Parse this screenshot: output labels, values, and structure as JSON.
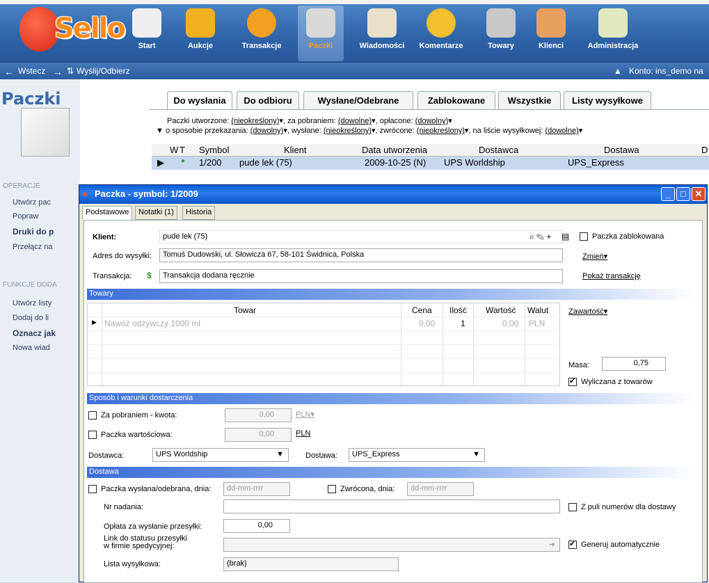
{
  "nav": {
    "items": [
      {
        "label": "Start",
        "color": "#eeeeee"
      },
      {
        "label": "Aukcje",
        "color": "#f0b020"
      },
      {
        "label": "Transakcje",
        "color": "#f2a020"
      },
      {
        "label": "Paczki",
        "color": "#d8d8d8"
      },
      {
        "label": "Wiadomości",
        "color": "#e8e0c8"
      },
      {
        "label": "Komentarze",
        "color": "#f2c030"
      },
      {
        "label": "Towary",
        "color": "#c8c8c8"
      },
      {
        "label": "Klienci",
        "color": "#e8a060"
      },
      {
        "label": "Administracja",
        "color": "#e0e8c0"
      }
    ],
    "logo": "Sello"
  },
  "toolbar": {
    "back": "Wstecz",
    "forward_icon": "→",
    "send": "Wyślij/Odbierz",
    "account": "Konto: ins_demo na"
  },
  "left": {
    "title": "Paczki",
    "section1": "OPERACJE",
    "ops": [
      "Utwórz pac",
      "Popraw",
      "Druki do p",
      "Przełącz na"
    ],
    "section2": "FUNKCJE DODA",
    "funcs": [
      "Utwórz listy",
      "Dodaj do li",
      "Oznacz jak",
      "Nowa wiad"
    ]
  },
  "tabs": [
    "Do wysłania",
    "Do odbioru",
    "Wysłane/Odebrane",
    "Zablokowane",
    "Wszystkie",
    "Listy wysyłkowe"
  ],
  "filters": {
    "l1a": "Paczki utworzone:",
    "v1a": "(nieokreślony)",
    "l1b": ", za pobraniem:",
    "v1b": "(dowolne)",
    "l1c": ", opłacone:",
    "v1c": "(dowolny)",
    "l2a": "o sposobie przekazania:",
    "v2a": "(dowolny)",
    "l2b": ", wysłane:",
    "v2b": "(nieokreślony)",
    "l2c": ", zwrócone:",
    "v2c": "(nieokreślony)",
    "l2d": ", na liście wysyłkowej:",
    "v2d": "(dowolne)"
  },
  "table": {
    "headers": [
      "W",
      "T",
      "Symbol",
      "Klient",
      "Data utworzenia",
      "Dostawca",
      "Dostawa",
      "D"
    ],
    "row": {
      "symbol": "1/200",
      "klient": "pude lek (75)",
      "data": "2009-10-25 (N)",
      "dostawca": "UPS Worldship",
      "dostawa": "UPS_Express"
    }
  },
  "dialog": {
    "title": "Paczka - symbol: 1/2009",
    "tabs": [
      "Podstawowe",
      "Notatki (1)",
      "Historia"
    ],
    "klient_label": "Klient:",
    "klient_value": "pude lek (75)",
    "zablokowana": "Paczka zablokowana",
    "adres_label": "Adres do wysyłki:",
    "adres_value": "Tomuś Dudowski, ul. Słowicza 67, 58-101 Świdnica, Polska",
    "zmien": "Zmień",
    "trans_label": "Transakcja:",
    "trans_value": "Transakcja dodana ręcznie",
    "pokaz": "Pokaż transakcję",
    "towary_section": "Towary",
    "grid_headers": [
      "Towar",
      "Cena",
      "Ilość",
      "Wartość",
      "Walut"
    ],
    "grid_row": {
      "towar": "Nawóz odżywczy 1000 ml",
      "cena": "0,00",
      "ilosc": "1",
      "wartosc": "0,00",
      "waluta": "PLN"
    },
    "zawartosc": "Zawartość",
    "masa_label": "Masa:",
    "masa_value": "0,75",
    "wyliczana": "Wyliczana z towarów",
    "sposob_section": "Sposób i warunki dostarczenia",
    "pobranie_label": "Za pobraniem - kwota:",
    "pobranie_value": "0,00",
    "pobranie_cur": "PLN",
    "wartosc_label": "Paczka wartościowa:",
    "wartosc_value": "0,00",
    "wartosc_cur": "PLN",
    "dostawca_label": "Dostawca:",
    "dostawca_value": "UPS Worldship",
    "dostawa_label": "Dostawa:",
    "dostawa_value": "UPS_Express",
    "dostawa_section": "Dostawa",
    "wyslana_label": "Paczka wysłana/odebrana, dnia:",
    "date_placeholder": "dd-mm-rrrr",
    "zwrocona_label": "Zwrócona, dnia:",
    "nr_label": "Nr nadania:",
    "zpuli": "Z puli numerów dla dostawy",
    "oplata_label": "Opłata za wysłanie przesyłki:",
    "oplata_value": "0,00",
    "link_label1": "Link do statusu przesyłki",
    "link_label2": "w firmie spedycyjnej:",
    "generuj": "Generuj automatycznie",
    "lista_label": "Lista wysyłkowa:",
    "lista_value": "(brak)"
  }
}
